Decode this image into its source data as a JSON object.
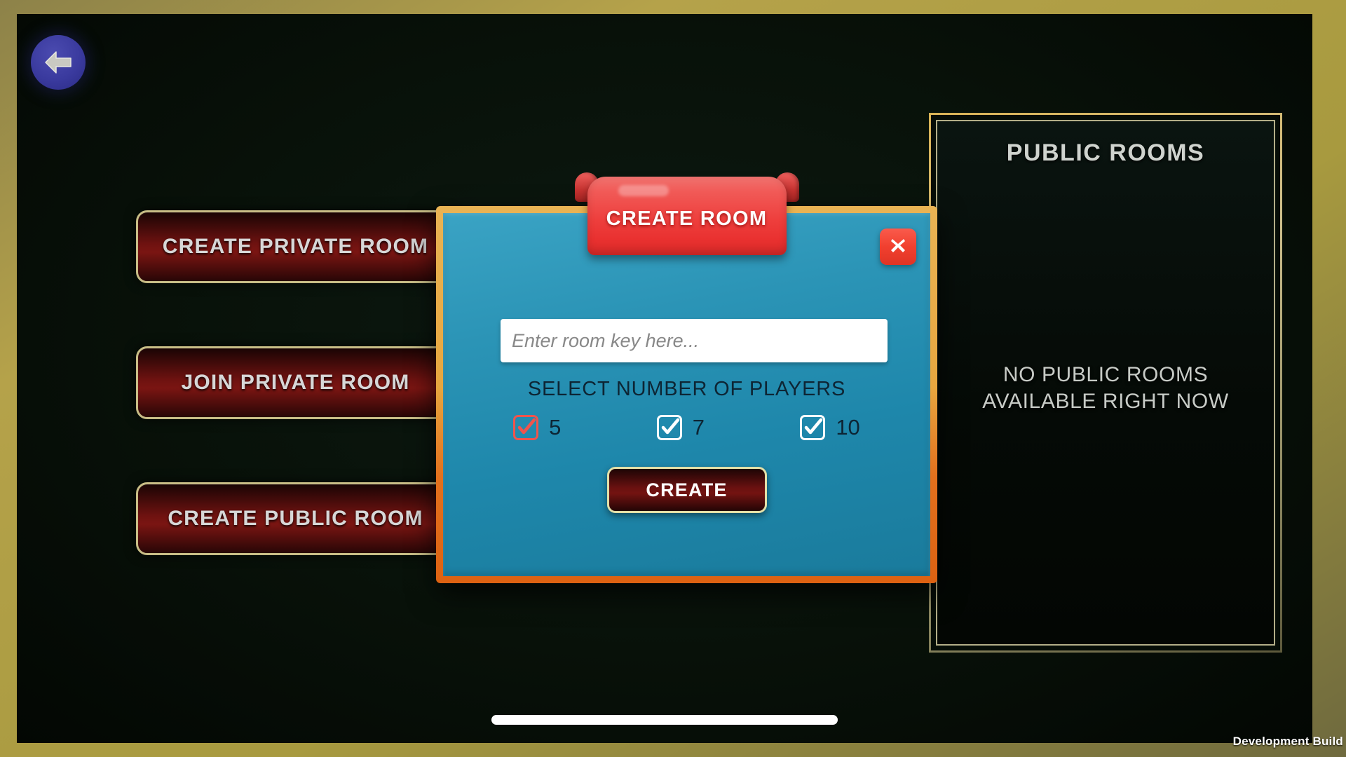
{
  "app": {
    "watermark": "Development Build"
  },
  "nav": {
    "back_label": "Back",
    "back_icon": "arrow-left-icon"
  },
  "menu": {
    "buttons": [
      {
        "label": "CREATE PRIVATE ROOM"
      },
      {
        "label": "JOIN PRIVATE ROOM"
      },
      {
        "label": "CREATE PUBLIC ROOM"
      }
    ]
  },
  "public_rooms": {
    "title": "PUBLIC ROOMS",
    "empty_line1": "NO PUBLIC ROOMS",
    "empty_line2": "AVAILABLE RIGHT NOW"
  },
  "dialog": {
    "title": "CREATE ROOM",
    "close_icon": "close-x-icon",
    "room_key": {
      "value": "",
      "placeholder": "Enter room key here..."
    },
    "players_label": "SELECT NUMBER OF PLAYERS",
    "player_options": [
      {
        "value": "5",
        "checked": true,
        "highlight": true
      },
      {
        "value": "7",
        "checked": true,
        "highlight": false
      },
      {
        "value": "10",
        "checked": true,
        "highlight": false
      }
    ],
    "create_label": "CREATE"
  },
  "colors": {
    "frame_gold": "#b5a24a",
    "playfield": "#081109",
    "dialog_border": "#e2701d",
    "dialog_body": "#2b94b6",
    "ribbon_red": "#ee3f3d",
    "button_red": "#6d1210",
    "button_border_gold": "#c8bd86",
    "selected_checkbox": "#f0544c",
    "back_button_blue": "#3a3a9e"
  }
}
